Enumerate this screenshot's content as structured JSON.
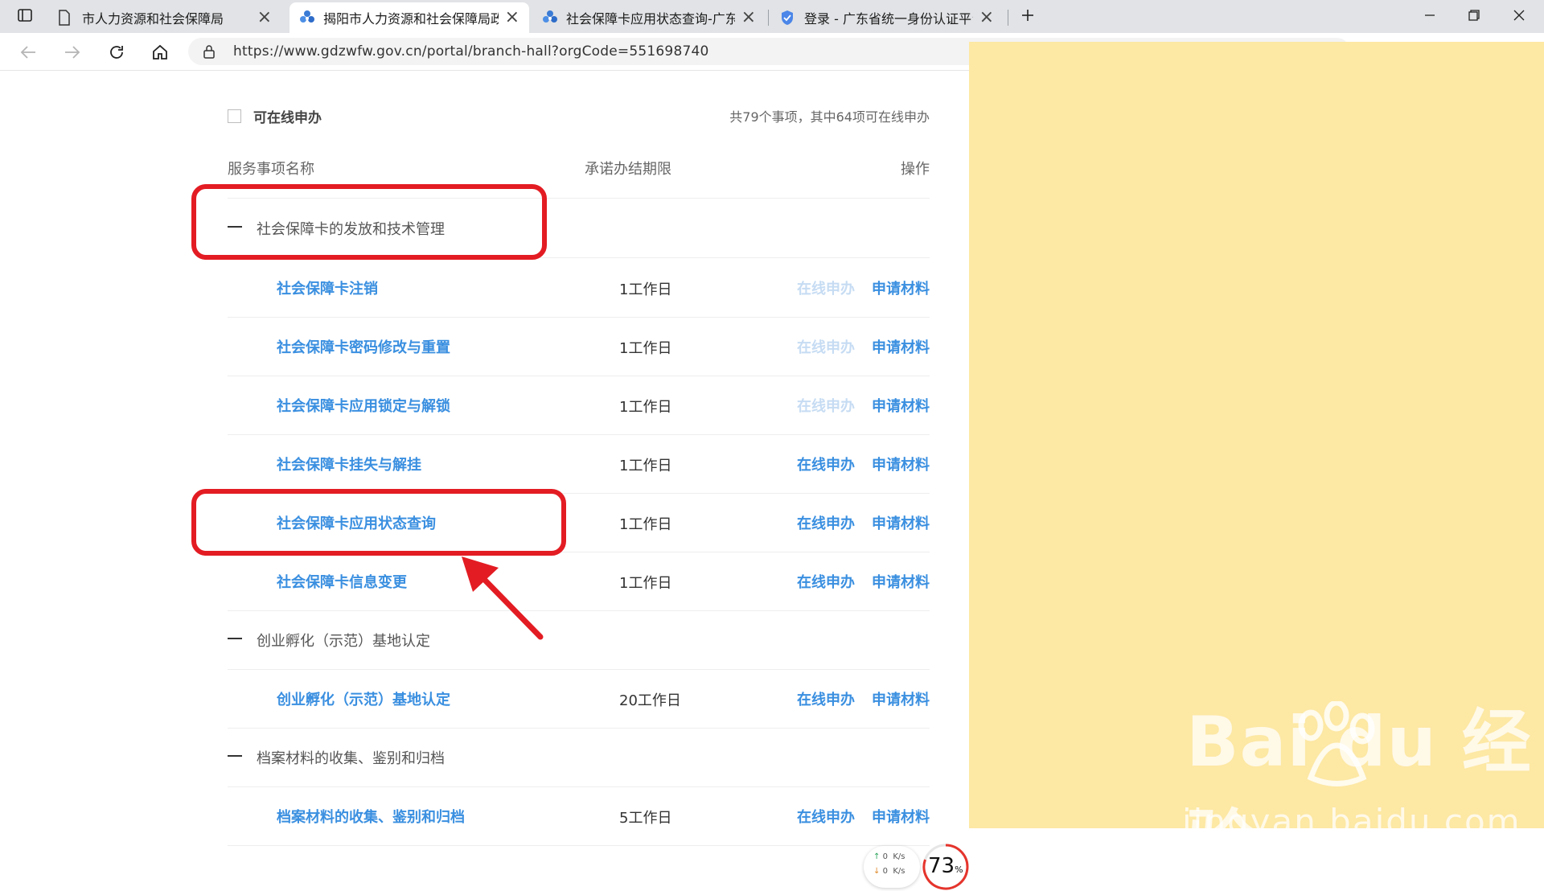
{
  "browser": {
    "tabs": [
      {
        "title": "市人力资源和社会保障局",
        "icon": "page-icon"
      },
      {
        "title": "揭阳市人力资源和社会保障局政务",
        "icon": "gov-flower-icon",
        "active": true
      },
      {
        "title": "社会保障卡应用状态查询-广东政",
        "icon": "gov-flower-icon"
      },
      {
        "title": "登录 - 广东省统一身份认证平台",
        "icon": "shield-icon"
      }
    ],
    "url": "https://www.gdzwfw.gov.cn/portal/branch-hall?orgCode=551698740"
  },
  "filter": {
    "checkbox_label": "可在线申办",
    "summary": "共79个事项，其中64项可在线申办"
  },
  "table": {
    "headers": {
      "name": "服务事项名称",
      "deadline": "承诺办结期限",
      "action": "操作"
    },
    "rows": [
      {
        "type": "group",
        "name": "社会保障卡的发放和技术管理"
      },
      {
        "type": "item",
        "name": "社会保障卡注销",
        "deadline": "1工作日",
        "online": "在线申办",
        "online_enabled": false,
        "material": "申请材料"
      },
      {
        "type": "item",
        "name": "社会保障卡密码修改与重置",
        "deadline": "1工作日",
        "online": "在线申办",
        "online_enabled": false,
        "material": "申请材料"
      },
      {
        "type": "item",
        "name": "社会保障卡应用锁定与解锁",
        "deadline": "1工作日",
        "online": "在线申办",
        "online_enabled": false,
        "material": "申请材料"
      },
      {
        "type": "item",
        "name": "社会保障卡挂失与解挂",
        "deadline": "1工作日",
        "online": "在线申办",
        "online_enabled": true,
        "material": "申请材料"
      },
      {
        "type": "item",
        "name": "社会保障卡应用状态查询",
        "deadline": "1工作日",
        "online": "在线申办",
        "online_enabled": true,
        "material": "申请材料"
      },
      {
        "type": "item",
        "name": "社会保障卡信息变更",
        "deadline": "1工作日",
        "online": "在线申办",
        "online_enabled": true,
        "material": "申请材料"
      },
      {
        "type": "group",
        "name": "创业孵化（示范）基地认定"
      },
      {
        "type": "item",
        "name": "创业孵化（示范）基地认定",
        "deadline": "20工作日",
        "online": "在线申办",
        "online_enabled": true,
        "material": "申请材料"
      },
      {
        "type": "group",
        "name": "档案材料的收集、鉴别和归档"
      },
      {
        "type": "item",
        "name": "档案材料的收集、鉴别和归档",
        "deadline": "5工作日",
        "online": "在线申办",
        "online_enabled": true,
        "material": "申请材料"
      }
    ]
  },
  "net_widget": {
    "up": "0",
    "down": "0",
    "unit": "K/s",
    "percent": "73",
    "percent_sign": "%"
  },
  "watermark": {
    "main": "Bai du 经验",
    "sub": "jingyan.baidu.com"
  },
  "colors": {
    "link_blue": "#3a8fe0",
    "link_disabled": "#c6dcf3",
    "annotation_red": "#e31c23",
    "side_panel": "#fde8a4"
  }
}
